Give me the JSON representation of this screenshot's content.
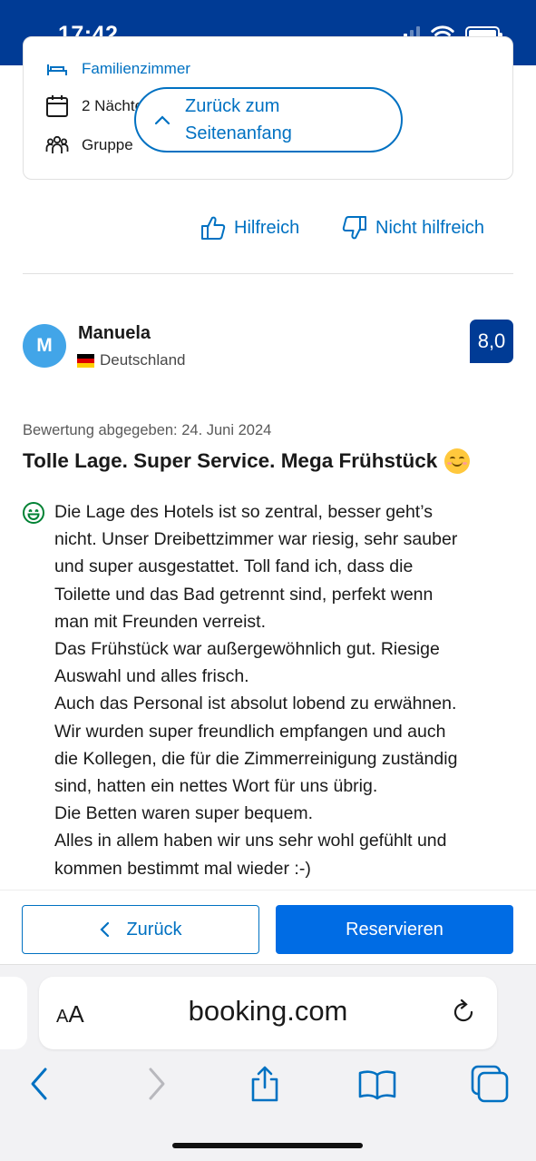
{
  "status_bar": {
    "time": "17:42"
  },
  "booking_info": {
    "room_label": "Familienzimmer",
    "nights_label": "2 Nächte",
    "group_label": "Gruppe"
  },
  "back_to_top": {
    "label": "Zurück zum Seitenanfang"
  },
  "feedback": {
    "helpful_label": "Hilfreich",
    "not_helpful_label": "Nicht hilfreich"
  },
  "reviewer": {
    "initial": "M",
    "name": "Manuela",
    "country": "Deutschland",
    "score": "8,0"
  },
  "review": {
    "date": "Bewertung abgegeben: 24. Juni 2024",
    "title": "Tolle Lage. Super Service. Mega Frühstück",
    "body": "Die Lage des Hotels ist so zentral, besser geht’s\nnicht. Unser Dreibettzimmer war riesig, sehr sauber\nund super ausgestattet. Toll fand ich, dass die\nToilette und das Bad getrennt sind, perfekt wenn\nman mit Freunden verreist.\nDas Frühstück war außergewöhnlich gut. Riesige\nAuswahl und alles frisch.\nAuch das Personal ist absolut lobend zu erwähnen.\nWir wurden super freundlich empfangen und auch\ndie Kollegen, die für die Zimmerreinigung zuständig\nsind, hatten ein nettes Wort für uns übrig.\nDie Betten waren super bequem.\nAlles in allem haben wir uns sehr wohl gefühlt und\nkommen bestimmt mal wieder :-)"
  },
  "actions": {
    "back_label": "Zurück",
    "reserve_label": "Reservieren"
  },
  "browser": {
    "aa_label": "AA",
    "url": "booking.com"
  },
  "colors": {
    "brand_dark": "#003b95",
    "link_blue": "#0071c2",
    "primary_button": "#006ce4",
    "positive_green": "#008234"
  }
}
